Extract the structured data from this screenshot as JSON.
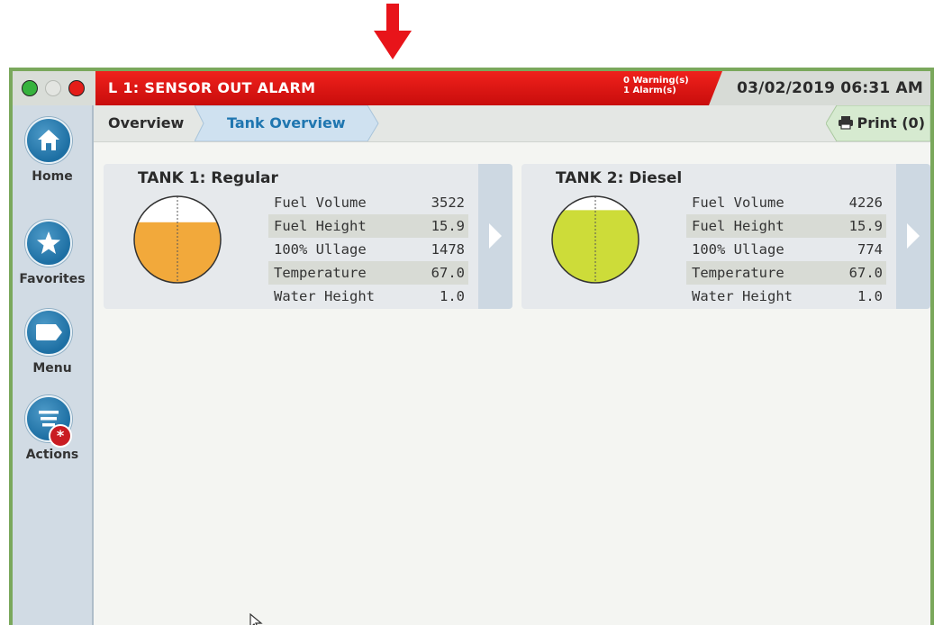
{
  "window": {
    "traffic_lights": [
      "green",
      "gray",
      "red"
    ]
  },
  "alarm_banner": {
    "title": "L 1: SENSOR OUT ALARM",
    "warnings": "0 Warning(s)",
    "alarms": "1 Alarm(s)",
    "color": "#e01512"
  },
  "datetime": "03/02/2019 06:31 AM",
  "sidebar": {
    "items": [
      {
        "label": "Home",
        "icon": "home-icon"
      },
      {
        "label": "Favorites",
        "icon": "star-icon"
      },
      {
        "label": "Menu",
        "icon": "tag-icon"
      },
      {
        "label": "Actions",
        "icon": "list-icon",
        "badge": "*"
      }
    ]
  },
  "breadcrumb": {
    "items": [
      "Overview",
      "Tank Overview"
    ],
    "active": "Tank Overview"
  },
  "print_button": {
    "label": "Print (0)",
    "icon": "printer-icon"
  },
  "tanks": [
    {
      "title": "TANK 1: Regular",
      "fill_fraction": 0.7,
      "fill_color": "#f2a93b",
      "rows": [
        {
          "label": "Fuel Volume",
          "value": "3522"
        },
        {
          "label": "Fuel Height",
          "value": "15.9"
        },
        {
          "label": "100% Ullage",
          "value": "1478"
        },
        {
          "label": "Temperature",
          "value": "67.0"
        },
        {
          "label": "Water Height",
          "value": "1.0"
        }
      ]
    },
    {
      "title": "TANK 2: Diesel",
      "fill_fraction": 0.84,
      "fill_color": "#cddc39",
      "rows": [
        {
          "label": "Fuel Volume",
          "value": "4226"
        },
        {
          "label": "Fuel Height",
          "value": "15.9"
        },
        {
          "label": "100% Ullage",
          "value": "774"
        },
        {
          "label": "Temperature",
          "value": "67.0"
        },
        {
          "label": "Water Height",
          "value": "1.0"
        }
      ]
    }
  ],
  "colors": {
    "frame_border": "#7aa85c",
    "indicator_arrow": "#e8141a",
    "active_crumb": "#1f76b0"
  }
}
